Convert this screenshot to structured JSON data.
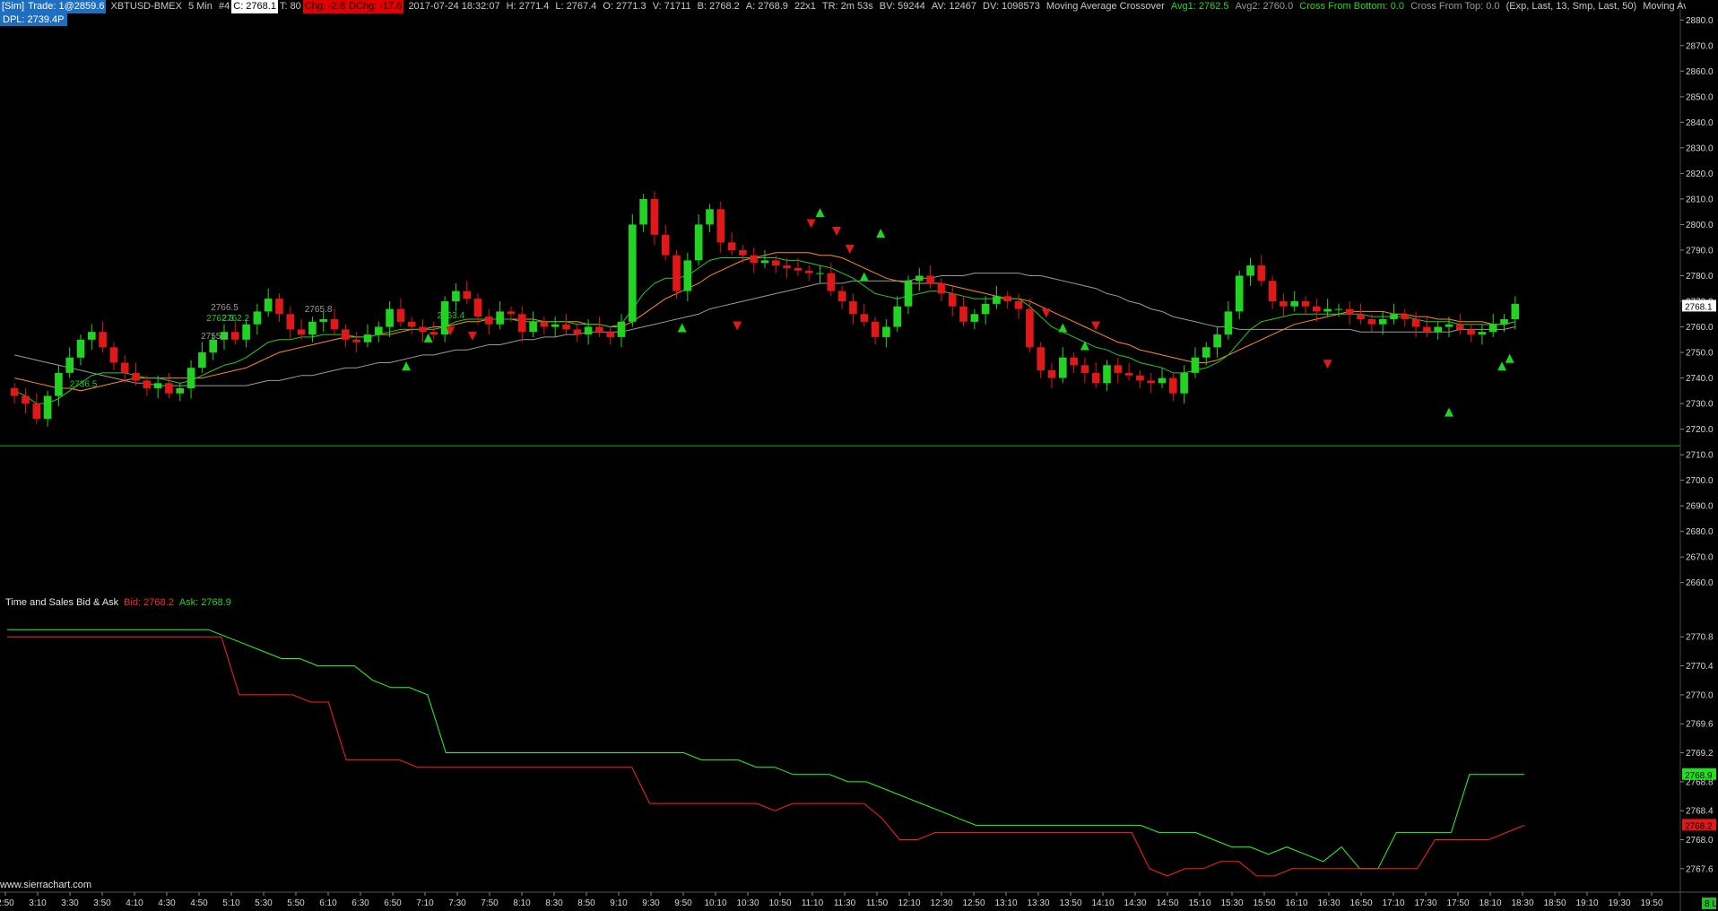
{
  "header": {
    "account": "[Sim]",
    "trade": "Trade: 1@2859.6",
    "symbol": "XBTUSD-BMEX",
    "timeframe": "5 Min",
    "chart_num": "#4",
    "close": "C: 2768.1",
    "ticks": "T: 80",
    "change": "Chg: -2.8",
    "dchange": "DChg: -17.6",
    "datetime": "2017-07-24 18:32:07",
    "high": "H: 2771.4",
    "low": "L: 2767.4",
    "open": "O: 2771.3",
    "volume": "V: 71711",
    "bid": "B: 2768.2",
    "ask": "A: 2768.9",
    "size": "22x1",
    "time_remaining": "TR: 2m 53s",
    "bid_volume": "BV: 59244",
    "ask_volume": "AV: 12467",
    "delta_volume": "DV: 1098573",
    "study_name": "Moving Average Crossover",
    "avg1": "Avg1: 2762.5",
    "avg2": "Avg2: 2760.0",
    "cross_bottom": "Cross From Bottom: 0.0",
    "cross_top": "Cross From Top: 0.0",
    "study_params": "(Exp, Last, 13, Smp, Last, 50)",
    "study_name_2": "Moving Av"
  },
  "dpl": "DPL: 2739.4P",
  "time_sales": {
    "title": "Time and Sales Bid & Ask",
    "bid": "Bid: 2768.2",
    "ask": "Ask: 2768.9"
  },
  "watermark": "www.sierrachart.com",
  "colors": {
    "up": "#22d422",
    "down": "#e01818",
    "ema": "#22cc22",
    "sma": "#ff8c1a",
    "long_ma": "#9a9a9a",
    "hline": "#18b418",
    "bid": "#ff2020",
    "ask": "#20ff20"
  },
  "price_axis": {
    "labels": [
      "2880.0",
      "2870.0",
      "2860.0",
      "2850.0",
      "2840.0",
      "2830.0",
      "2820.0",
      "2810.0",
      "2800.0",
      "2790.0",
      "2780.0",
      "2770.0",
      "2760.0",
      "2750.0",
      "2740.0",
      "2730.0",
      "2720.0",
      "2710.0",
      "2700.0",
      "2690.0",
      "2680.0",
      "2670.0",
      "2660.0"
    ],
    "current": "2768.1",
    "current_value": 2768.1
  },
  "ts_axis": {
    "labels": [
      "2770.8",
      "2770.4",
      "2770.0",
      "2769.6",
      "2769.2",
      "2768.8",
      "2768.4",
      "2768.0",
      "2767.6"
    ],
    "ask_tag": "2768.9",
    "bid_tag": "2768.2",
    "ask_value": 2768.9,
    "bid_value": 2768.2
  },
  "time_axis": {
    "labels": [
      "2:50",
      "3:10",
      "3:30",
      "3:50",
      "4:10",
      "4:30",
      "4:50",
      "5:10",
      "5:30",
      "5:50",
      "6:10",
      "6:30",
      "6:50",
      "7:10",
      "7:30",
      "7:50",
      "8:10",
      "8:30",
      "8:50",
      "9:10",
      "9:30",
      "9:50",
      "10:10",
      "10:30",
      "10:50",
      "11:10",
      "11:30",
      "11:50",
      "12:10",
      "12:30",
      "12:50",
      "13:10",
      "13:30",
      "13:50",
      "14:10",
      "14:30",
      "14:50",
      "15:10",
      "15:30",
      "15:50",
      "16:10",
      "16:30",
      "16:50",
      "17:10",
      "17:30",
      "17:50",
      "18:10",
      "18:30",
      "18:50",
      "19:10",
      "19:30",
      "19:50"
    ],
    "end_tag": "8 L"
  },
  "chart_labels": [
    {
      "text": "2736.5",
      "t": 5.0,
      "v": 2736.5,
      "color": "#22cc22"
    },
    {
      "text": "2755.2",
      "t": 16.9,
      "v": 2755.2,
      "color": "#9a9a9a"
    },
    {
      "text": "2766.5",
      "t": 17.8,
      "v": 2766.5,
      "color": "#9a9a9a"
    },
    {
      "text": "2762.3",
      "t": 17.4,
      "v": 2762.3,
      "color": "#22cc22"
    },
    {
      "text": "2762.2",
      "t": 18.8,
      "v": 2762.2,
      "color": "#22cc22"
    },
    {
      "text": "2765.8",
      "t": 26.3,
      "v": 2765.8,
      "color": "#9a9a9a"
    },
    {
      "text": "2763.4",
      "t": 38.3,
      "v": 2763.4,
      "color": "#22cc22"
    }
  ],
  "chart_data": {
    "type": "line",
    "title": "XBTUSD-BMEX 5 Min",
    "price_panel": {
      "ylim": [
        2655,
        2885
      ],
      "x_unit": "5-min bar index from 2:50",
      "close": [
        2733,
        2730,
        2724,
        2733,
        2742,
        2748,
        2755,
        2758,
        2752,
        2746,
        2742,
        2739,
        2736,
        2738,
        2734,
        2736,
        2744,
        2750,
        2755,
        2758,
        2755,
        2761,
        2766,
        2771,
        2765,
        2759,
        2757,
        2762,
        2763,
        2759,
        2755,
        2754,
        2757,
        2760,
        2767,
        2762,
        2760,
        2758,
        2757,
        2770,
        2774,
        2771,
        2764,
        2761,
        2766,
        2765,
        2758,
        2762,
        2760,
        2761,
        2759,
        2757,
        2760,
        2758,
        2756,
        2762,
        2800,
        2810,
        2796,
        2788,
        2774,
        2786,
        2800,
        2806,
        2793,
        2790,
        2788,
        2785,
        2786,
        2784,
        2783,
        2782,
        2781,
        2781,
        2774,
        2770,
        2765,
        2762,
        2756,
        2760,
        2768,
        2778,
        2780,
        2777,
        2773,
        2768,
        2762,
        2765,
        2769,
        2772,
        2770,
        2767,
        2752,
        2743,
        2740,
        2748,
        2745,
        2742,
        2738,
        2745,
        2742,
        2741,
        2739,
        2738,
        2740,
        2734,
        2742,
        2748,
        2752,
        2757,
        2766,
        2780,
        2784,
        2778,
        2770,
        2768,
        2770,
        2768,
        2766,
        2767,
        2767,
        2765,
        2763,
        2761,
        2763,
        2765,
        2763,
        2760,
        2758,
        2760,
        2761,
        2759,
        2757,
        2758,
        2761,
        2763,
        2769
      ],
      "ema13": [
        2735,
        2733,
        2730,
        2730,
        2732,
        2735,
        2738,
        2741,
        2742,
        2742,
        2742,
        2741,
        2740,
        2740,
        2739,
        2738,
        2739,
        2741,
        2743,
        2745,
        2746,
        2748,
        2751,
        2754,
        2755,
        2755,
        2756,
        2756,
        2757,
        2757,
        2757,
        2756,
        2756,
        2757,
        2758,
        2759,
        2759,
        2759,
        2759,
        2760,
        2762,
        2763,
        2763,
        2763,
        2763,
        2763,
        2762,
        2762,
        2762,
        2762,
        2762,
        2761,
        2761,
        2761,
        2760,
        2761,
        2767,
        2773,
        2777,
        2779,
        2779,
        2780,
        2783,
        2786,
        2787,
        2787,
        2787,
        2787,
        2787,
        2787,
        2786,
        2786,
        2785,
        2784,
        2783,
        2781,
        2779,
        2776,
        2773,
        2772,
        2771,
        2772,
        2773,
        2774,
        2774,
        2773,
        2772,
        2771,
        2771,
        2771,
        2771,
        2771,
        2768,
        2764,
        2760,
        2758,
        2756,
        2754,
        2752,
        2751,
        2749,
        2748,
        2746,
        2745,
        2744,
        2742,
        2742,
        2743,
        2744,
        2746,
        2749,
        2754,
        2759,
        2762,
        2763,
        2764,
        2765,
        2765,
        2765,
        2765,
        2765,
        2765,
        2765,
        2764,
        2764,
        2764,
        2764,
        2763,
        2762,
        2762,
        2762,
        2761,
        2761,
        2761,
        2761,
        2761,
        2762
      ],
      "sma": [
        2740,
        2739,
        2738,
        2737,
        2736,
        2736,
        2735,
        2736,
        2737,
        2738,
        2739,
        2740,
        2740,
        2740,
        2740,
        2740,
        2740,
        2740,
        2741,
        2742,
        2743,
        2744,
        2746,
        2748,
        2750,
        2751,
        2752,
        2753,
        2754,
        2755,
        2756,
        2756,
        2756,
        2757,
        2757,
        2758,
        2759,
        2759,
        2760,
        2760,
        2761,
        2762,
        2762,
        2763,
        2763,
        2763,
        2763,
        2763,
        2762,
        2762,
        2762,
        2762,
        2761,
        2761,
        2760,
        2760,
        2762,
        2765,
        2768,
        2771,
        2773,
        2775,
        2777,
        2780,
        2782,
        2784,
        2786,
        2787,
        2788,
        2789,
        2789,
        2789,
        2789,
        2788,
        2788,
        2787,
        2785,
        2783,
        2781,
        2779,
        2778,
        2777,
        2777,
        2777,
        2777,
        2776,
        2775,
        2774,
        2773,
        2772,
        2771,
        2771,
        2770,
        2768,
        2766,
        2764,
        2762,
        2760,
        2758,
        2756,
        2754,
        2753,
        2751,
        2750,
        2749,
        2748,
        2747,
        2746,
        2746,
        2747,
        2749,
        2751,
        2753,
        2755,
        2757,
        2759,
        2761,
        2762,
        2763,
        2764,
        2765,
        2766,
        2766,
        2766,
        2766,
        2765,
        2765,
        2764,
        2764,
        2763,
        2763,
        2762,
        2762,
        2762,
        2761,
        2761,
        2762
      ],
      "ma_long": [
        2749,
        2748,
        2747,
        2746,
        2745,
        2744,
        2743,
        2742,
        2741,
        2740,
        2739,
        2738,
        2738,
        2737,
        2737,
        2737,
        2737,
        2737,
        2737,
        2737,
        2737,
        2737,
        2738,
        2739,
        2739,
        2740,
        2741,
        2741,
        2742,
        2743,
        2744,
        2744,
        2745,
        2746,
        2746,
        2747,
        2748,
        2749,
        2749,
        2750,
        2751,
        2751,
        2752,
        2753,
        2753,
        2754,
        2755,
        2755,
        2756,
        2756,
        2757,
        2757,
        2758,
        2758,
        2758,
        2758,
        2759,
        2760,
        2761,
        2762,
        2763,
        2764,
        2765,
        2767,
        2768,
        2769,
        2770,
        2771,
        2772,
        2773,
        2774,
        2775,
        2776,
        2777,
        2777,
        2777,
        2778,
        2778,
        2778,
        2778,
        2778,
        2778,
        2779,
        2779,
        2780,
        2780,
        2780,
        2781,
        2781,
        2781,
        2781,
        2781,
        2780,
        2780,
        2779,
        2778,
        2777,
        2776,
        2775,
        2773,
        2772,
        2770,
        2769,
        2767,
        2766,
        2764,
        2763,
        2762,
        2761,
        2760,
        2760,
        2759,
        2759,
        2759,
        2759,
        2759,
        2759,
        2759,
        2759,
        2759,
        2759,
        2759,
        2758,
        2758,
        2758,
        2758,
        2758,
        2758,
        2758,
        2758,
        2758,
        2759,
        2759,
        2759,
        2759,
        2759,
        2760
      ]
    },
    "time_sales_panel": {
      "ylim": [
        2767.4,
        2771.1
      ],
      "ask": [
        2770.9,
        2770.9,
        2770.9,
        2770.9,
        2770.9,
        2770.9,
        2770.9,
        2770.9,
        2770.9,
        2770.9,
        2770.9,
        2770.9,
        2770.8,
        2770.7,
        2770.6,
        2770.5,
        2770.5,
        2770.4,
        2770.4,
        2770.4,
        2770.2,
        2770.1,
        2770.1,
        2770.0,
        2769.2,
        2769.2,
        2769.2,
        2769.2,
        2769.2,
        2769.2,
        2769.2,
        2769.2,
        2769.2,
        2769.2,
        2769.2,
        2769.2,
        2769.2,
        2769.2,
        2769.1,
        2769.1,
        2769.1,
        2769.0,
        2769.0,
        2768.9,
        2768.9,
        2768.9,
        2768.8,
        2768.8,
        2768.7,
        2768.6,
        2768.5,
        2768.4,
        2768.3,
        2768.2,
        2768.2,
        2768.2,
        2768.2,
        2768.2,
        2768.2,
        2768.2,
        2768.2,
        2768.2,
        2768.2,
        2768.1,
        2768.1,
        2768.1,
        2768.0,
        2767.9,
        2767.9,
        2767.8,
        2767.9,
        2767.8,
        2767.7,
        2767.9,
        2767.6,
        2767.6,
        2768.1,
        2768.1,
        2768.1,
        2768.1,
        2768.9,
        2768.9,
        2768.9,
        2768.9
      ],
      "bid": [
        2770.8,
        2770.8,
        2770.8,
        2770.8,
        2770.8,
        2770.8,
        2770.8,
        2770.8,
        2770.8,
        2770.8,
        2770.8,
        2770.8,
        2770.8,
        2770.0,
        2770.0,
        2770.0,
        2770.0,
        2769.9,
        2769.9,
        2769.1,
        2769.1,
        2769.1,
        2769.1,
        2769.0,
        2769.0,
        2769.0,
        2769.0,
        2769.0,
        2769.0,
        2769.0,
        2769.0,
        2769.0,
        2769.0,
        2769.0,
        2769.0,
        2769.0,
        2768.5,
        2768.5,
        2768.5,
        2768.5,
        2768.5,
        2768.5,
        2768.5,
        2768.4,
        2768.5,
        2768.5,
        2768.5,
        2768.5,
        2768.5,
        2768.3,
        2768.0,
        2768.0,
        2768.1,
        2768.1,
        2768.1,
        2768.1,
        2768.1,
        2768.1,
        2768.1,
        2768.1,
        2768.1,
        2768.1,
        2768.1,
        2768.1,
        2767.6,
        2767.5,
        2767.6,
        2767.6,
        2767.7,
        2767.7,
        2767.5,
        2767.5,
        2767.6,
        2767.6,
        2767.6,
        2767.6,
        2767.6,
        2767.6,
        2767.6,
        2767.6,
        2768.0,
        2768.0,
        2768.0,
        2768.0,
        2768.1,
        2768.2
      ]
    },
    "signal_arrows": [
      {
        "t": 35.5,
        "v": 2745,
        "dir": "up"
      },
      {
        "t": 37.5,
        "v": 2756,
        "dir": "up"
      },
      {
        "t": 39.5,
        "v": 2758,
        "dir": "down"
      },
      {
        "t": 41.5,
        "v": 2756,
        "dir": "down"
      },
      {
        "t": 60.5,
        "v": 2760,
        "dir": "up"
      },
      {
        "t": 65.5,
        "v": 2760,
        "dir": "down"
      },
      {
        "t": 72.2,
        "v": 2800,
        "dir": "down"
      },
      {
        "t": 73.0,
        "v": 2805,
        "dir": "up"
      },
      {
        "t": 74.5,
        "v": 2797,
        "dir": "down"
      },
      {
        "t": 75.7,
        "v": 2790,
        "dir": "down"
      },
      {
        "t": 77.0,
        "v": 2780,
        "dir": "up"
      },
      {
        "t": 78.5,
        "v": 2797,
        "dir": "up"
      },
      {
        "t": 93.5,
        "v": 2765,
        "dir": "down"
      },
      {
        "t": 95.0,
        "v": 2760,
        "dir": "up"
      },
      {
        "t": 97.0,
        "v": 2753,
        "dir": "up"
      },
      {
        "t": 98.0,
        "v": 2760,
        "dir": "down"
      },
      {
        "t": 119.0,
        "v": 2745,
        "dir": "down"
      },
      {
        "t": 130.0,
        "v": 2727,
        "dir": "up"
      },
      {
        "t": 134.8,
        "v": 2745,
        "dir": "up"
      },
      {
        "t": 135.5,
        "v": 2748,
        "dir": "up"
      }
    ]
  }
}
